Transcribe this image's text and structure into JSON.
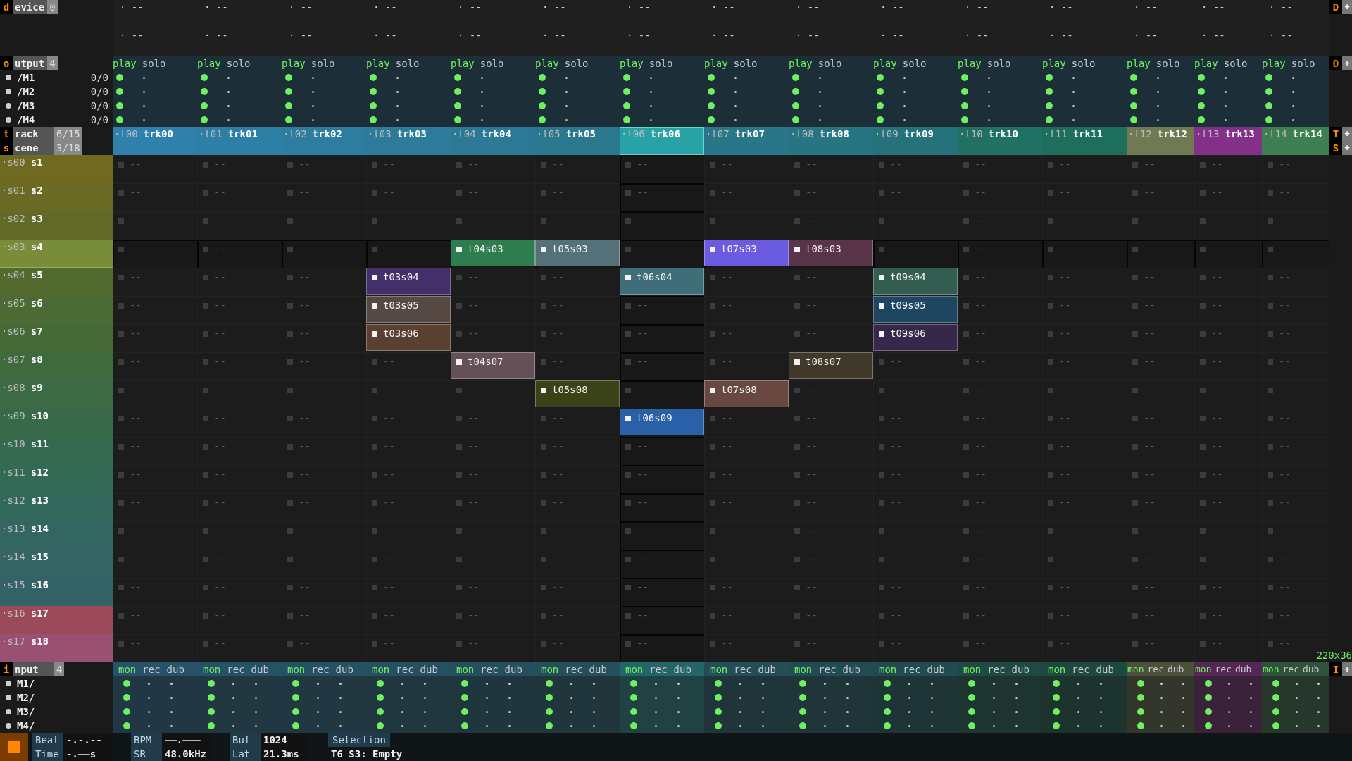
{
  "device": {
    "key": "d",
    "label": "evice",
    "count": "0",
    "right_key": "D",
    "right_add": "+"
  },
  "output": {
    "key": "o",
    "label": "utput",
    "count": "4",
    "right_key": "O",
    "right_add": "+",
    "ports": [
      {
        "name": "/M1",
        "reading": "0/0"
      },
      {
        "name": "/M2",
        "reading": "0/0"
      },
      {
        "name": "/M3",
        "reading": "0/0"
      },
      {
        "name": "/M4",
        "reading": "0/0"
      }
    ]
  },
  "track_header": {
    "key": "t",
    "label": "rack",
    "count": "6/15",
    "right_key": "T",
    "right_add": "+"
  },
  "scene_header": {
    "key": "s",
    "label": "cene",
    "count": "3/18",
    "right_key": "S",
    "right_add": "+"
  },
  "input": {
    "key": "i",
    "label": "nput",
    "count": "4",
    "right_key": "I",
    "right_add": "+",
    "ports": [
      {
        "name": "M1/"
      },
      {
        "name": "M2/"
      },
      {
        "name": "M3/"
      },
      {
        "name": "M4/"
      }
    ]
  },
  "scenes": [
    {
      "id": "·s00",
      "name": "s1",
      "color": "#706a20",
      "selected": false
    },
    {
      "id": "·s01",
      "name": "s2",
      "color": "#6b6a24",
      "selected": false
    },
    {
      "id": "·s02",
      "name": "s3",
      "color": "#636a28",
      "selected": false
    },
    {
      "id": "·s03",
      "name": "s4",
      "color": "#788c3a",
      "selected": true
    },
    {
      "id": "·s04",
      "name": "s5",
      "color": "#526a2e",
      "selected": false
    },
    {
      "id": "·s05",
      "name": "s6",
      "color": "#4b6a34",
      "selected": false
    },
    {
      "id": "·s06",
      "name": "s7",
      "color": "#456a38",
      "selected": false
    },
    {
      "id": "·s07",
      "name": "s8",
      "color": "#3f6a3e",
      "selected": false
    },
    {
      "id": "·s08",
      "name": "s9",
      "color": "#3b6a44",
      "selected": false
    },
    {
      "id": "·s09",
      "name": "s10",
      "color": "#386a4a",
      "selected": false
    },
    {
      "id": "·s10",
      "name": "s11",
      "color": "#356a50",
      "selected": false
    },
    {
      "id": "·s11",
      "name": "s12",
      "color": "#336a56",
      "selected": false
    },
    {
      "id": "·s12",
      "name": "s13",
      "color": "#33685c",
      "selected": false
    },
    {
      "id": "·s13",
      "name": "s14",
      "color": "#336660",
      "selected": false
    },
    {
      "id": "·s14",
      "name": "s15",
      "color": "#346464",
      "selected": false
    },
    {
      "id": "·s15",
      "name": "s16",
      "color": "#356268",
      "selected": false
    },
    {
      "id": "·s16",
      "name": "s17",
      "color": "#9a4a58",
      "selected": false
    },
    {
      "id": "·s17",
      "name": "s18",
      "color": "#9a5070",
      "selected": false
    }
  ],
  "tracks": [
    {
      "id": "·t00",
      "name": "trk00",
      "color": "#2f80ac",
      "selected": false,
      "device_slots": [
        "· --",
        "· --"
      ],
      "play_label": "play",
      "solo_label": "solo",
      "outputs": [
        {
          "play": true,
          "solo": false
        },
        {
          "play": true,
          "solo": false
        },
        {
          "play": true,
          "solo": false
        },
        {
          "play": true,
          "solo": false
        }
      ],
      "mon_label": "mon",
      "rec_label": "rec",
      "dub_label": "dub",
      "inputs": [
        {
          "mon": true,
          "rec": false,
          "dub": false
        },
        {
          "mon": true,
          "rec": false,
          "dub": false
        },
        {
          "mon": true,
          "rec": false,
          "dub": false
        },
        {
          "mon": true,
          "rec": false,
          "dub": false
        }
      ],
      "clips": [
        {
          "kind": "empty",
          "text": "--"
        },
        {
          "kind": "empty",
          "text": "--"
        },
        {
          "kind": "empty",
          "text": "--"
        },
        {
          "kind": "empty",
          "text": "--"
        },
        {
          "kind": "empty",
          "text": "--"
        },
        {
          "kind": "empty",
          "text": "--"
        },
        {
          "kind": "empty",
          "text": "--"
        },
        {
          "kind": "empty",
          "text": "--"
        },
        {
          "kind": "empty",
          "text": "--"
        },
        {
          "kind": "empty",
          "text": "--"
        },
        {
          "kind": "empty",
          "text": "--"
        },
        {
          "kind": "empty",
          "text": "--"
        },
        {
          "kind": "empty",
          "text": "--"
        },
        {
          "kind": "empty",
          "text": "--"
        },
        {
          "kind": "empty",
          "text": "--"
        },
        {
          "kind": "empty",
          "text": "--"
        },
        {
          "kind": "empty",
          "text": "--"
        },
        {
          "kind": "empty",
          "text": "--"
        }
      ]
    },
    {
      "id": "·t01",
      "name": "trk01",
      "color": "#2e7fa6",
      "selected": false,
      "device_slots": [
        "· --",
        "· --"
      ],
      "play_label": "play",
      "solo_label": "solo",
      "outputs": [
        {
          "play": true,
          "solo": false
        },
        {
          "play": true,
          "solo": false
        },
        {
          "play": true,
          "solo": false
        },
        {
          "play": true,
          "solo": false
        }
      ],
      "mon_label": "mon",
      "rec_label": "rec",
      "dub_label": "dub",
      "inputs": [
        {
          "mon": true,
          "rec": false,
          "dub": false
        },
        {
          "mon": true,
          "rec": false,
          "dub": false
        },
        {
          "mon": true,
          "rec": false,
          "dub": false
        },
        {
          "mon": true,
          "rec": false,
          "dub": false
        }
      ],
      "clips": [
        {
          "kind": "empty",
          "text": "--"
        },
        {
          "kind": "empty",
          "text": "--"
        },
        {
          "kind": "empty",
          "text": "--"
        },
        {
          "kind": "empty",
          "text": "--"
        },
        {
          "kind": "empty",
          "text": "--"
        },
        {
          "kind": "empty",
          "text": "--"
        },
        {
          "kind": "empty",
          "text": "--"
        },
        {
          "kind": "empty",
          "text": "--"
        },
        {
          "kind": "empty",
          "text": "--"
        },
        {
          "kind": "empty",
          "text": "--"
        },
        {
          "kind": "empty",
          "text": "--"
        },
        {
          "kind": "empty",
          "text": "--"
        },
        {
          "kind": "empty",
          "text": "--"
        },
        {
          "kind": "empty",
          "text": "--"
        },
        {
          "kind": "empty",
          "text": "--"
        },
        {
          "kind": "empty",
          "text": "--"
        },
        {
          "kind": "empty",
          "text": "--"
        },
        {
          "kind": "empty",
          "text": "--"
        }
      ]
    },
    {
      "id": "·t02",
      "name": "trk02",
      "color": "#2d7da0",
      "selected": false,
      "device_slots": [
        "· --",
        "· --"
      ],
      "play_label": "play",
      "solo_label": "solo",
      "outputs": [
        {
          "play": true,
          "solo": false
        },
        {
          "play": true,
          "solo": false
        },
        {
          "play": true,
          "solo": false
        },
        {
          "play": true,
          "solo": false
        }
      ],
      "mon_label": "mon",
      "rec_label": "rec",
      "dub_label": "dub",
      "inputs": [
        {
          "mon": true,
          "rec": false,
          "dub": false
        },
        {
          "mon": true,
          "rec": false,
          "dub": false
        },
        {
          "mon": true,
          "rec": false,
          "dub": false
        },
        {
          "mon": true,
          "rec": false,
          "dub": false
        }
      ],
      "clips": [
        {
          "kind": "empty",
          "text": "--"
        },
        {
          "kind": "empty",
          "text": "--"
        },
        {
          "kind": "empty",
          "text": "--"
        },
        {
          "kind": "empty",
          "text": "--"
        },
        {
          "kind": "empty",
          "text": "--"
        },
        {
          "kind": "empty",
          "text": "--"
        },
        {
          "kind": "empty",
          "text": "--"
        },
        {
          "kind": "empty",
          "text": "--"
        },
        {
          "kind": "empty",
          "text": "--"
        },
        {
          "kind": "empty",
          "text": "--"
        },
        {
          "kind": "empty",
          "text": "--"
        },
        {
          "kind": "empty",
          "text": "--"
        },
        {
          "kind": "empty",
          "text": "--"
        },
        {
          "kind": "empty",
          "text": "--"
        },
        {
          "kind": "empty",
          "text": "--"
        },
        {
          "kind": "empty",
          "text": "--"
        },
        {
          "kind": "empty",
          "text": "--"
        },
        {
          "kind": "empty",
          "text": "--"
        }
      ]
    },
    {
      "id": "·t03",
      "name": "trk03",
      "color": "#2c7b9a",
      "selected": false,
      "device_slots": [
        "· --",
        "· --"
      ],
      "play_label": "play",
      "solo_label": "solo",
      "outputs": [
        {
          "play": true,
          "solo": false
        },
        {
          "play": true,
          "solo": false
        },
        {
          "play": true,
          "solo": false
        },
        {
          "play": true,
          "solo": false
        }
      ],
      "mon_label": "mon",
      "rec_label": "rec",
      "dub_label": "dub",
      "inputs": [
        {
          "mon": true,
          "rec": false,
          "dub": false
        },
        {
          "mon": true,
          "rec": false,
          "dub": false
        },
        {
          "mon": true,
          "rec": false,
          "dub": false
        },
        {
          "mon": true,
          "rec": false,
          "dub": false
        }
      ],
      "clips": [
        {
          "kind": "empty",
          "text": "--"
        },
        {
          "kind": "empty",
          "text": "--"
        },
        {
          "kind": "empty",
          "text": "--"
        },
        {
          "kind": "empty",
          "text": "--"
        },
        {
          "kind": "clip",
          "name": "t03s04",
          "color": "#432f6a"
        },
        {
          "kind": "clip",
          "name": "t03s05",
          "color": "#564842"
        },
        {
          "kind": "clip",
          "name": "t03s06",
          "color": "#5a4030"
        },
        {
          "kind": "empty",
          "text": "--"
        },
        {
          "kind": "empty",
          "text": "--"
        },
        {
          "kind": "empty",
          "text": "--"
        },
        {
          "kind": "empty",
          "text": "--"
        },
        {
          "kind": "empty",
          "text": "--"
        },
        {
          "kind": "empty",
          "text": "--"
        },
        {
          "kind": "empty",
          "text": "--"
        },
        {
          "kind": "empty",
          "text": "--"
        },
        {
          "kind": "empty",
          "text": "--"
        },
        {
          "kind": "empty",
          "text": "--"
        },
        {
          "kind": "empty",
          "text": "--"
        }
      ]
    },
    {
      "id": "·t04",
      "name": "trk04",
      "color": "#2b7994",
      "selected": false,
      "device_slots": [
        "· --",
        "· --"
      ],
      "play_label": "play",
      "solo_label": "solo",
      "outputs": [
        {
          "play": true,
          "solo": false
        },
        {
          "play": true,
          "solo": false
        },
        {
          "play": true,
          "solo": false
        },
        {
          "play": true,
          "solo": false
        }
      ],
      "mon_label": "mon",
      "rec_label": "rec",
      "dub_label": "dub",
      "inputs": [
        {
          "mon": true,
          "rec": false,
          "dub": false
        },
        {
          "mon": true,
          "rec": false,
          "dub": false
        },
        {
          "mon": true,
          "rec": false,
          "dub": false
        },
        {
          "mon": true,
          "rec": false,
          "dub": false
        }
      ],
      "clips": [
        {
          "kind": "empty",
          "text": "--"
        },
        {
          "kind": "empty",
          "text": "--"
        },
        {
          "kind": "empty",
          "text": "--"
        },
        {
          "kind": "clip",
          "name": "t04s03",
          "color": "#2e7d4f"
        },
        {
          "kind": "empty",
          "text": "--"
        },
        {
          "kind": "empty",
          "text": "--"
        },
        {
          "kind": "empty",
          "text": "--"
        },
        {
          "kind": "clip",
          "name": "t04s07",
          "color": "#665058"
        },
        {
          "kind": "empty",
          "text": "--"
        },
        {
          "kind": "empty",
          "text": "--"
        },
        {
          "kind": "empty",
          "text": "--"
        },
        {
          "kind": "empty",
          "text": "--"
        },
        {
          "kind": "empty",
          "text": "--"
        },
        {
          "kind": "empty",
          "text": "--"
        },
        {
          "kind": "empty",
          "text": "--"
        },
        {
          "kind": "empty",
          "text": "--"
        },
        {
          "kind": "empty",
          "text": "--"
        },
        {
          "kind": "empty",
          "text": "--"
        }
      ]
    },
    {
      "id": "·t05",
      "name": "trk05",
      "color": "#2a788e",
      "selected": false,
      "device_slots": [
        "· --",
        "· --"
      ],
      "play_label": "play",
      "solo_label": "solo",
      "outputs": [
        {
          "play": true,
          "solo": false
        },
        {
          "play": true,
          "solo": false
        },
        {
          "play": true,
          "solo": false
        },
        {
          "play": true,
          "solo": false
        }
      ],
      "mon_label": "mon",
      "rec_label": "rec",
      "dub_label": "dub",
      "inputs": [
        {
          "mon": true,
          "rec": false,
          "dub": false
        },
        {
          "mon": true,
          "rec": false,
          "dub": false
        },
        {
          "mon": true,
          "rec": false,
          "dub": false
        },
        {
          "mon": true,
          "rec": false,
          "dub": false
        }
      ],
      "clips": [
        {
          "kind": "empty",
          "text": "--"
        },
        {
          "kind": "empty",
          "text": "--"
        },
        {
          "kind": "empty",
          "text": "--"
        },
        {
          "kind": "clip",
          "name": "t05s03",
          "color": "#547078"
        },
        {
          "kind": "empty",
          "text": "--"
        },
        {
          "kind": "empty",
          "text": "--"
        },
        {
          "kind": "empty",
          "text": "--"
        },
        {
          "kind": "empty",
          "text": "--"
        },
        {
          "kind": "clip",
          "name": "t05s08",
          "color": "#3a4218"
        },
        {
          "kind": "empty",
          "text": "--"
        },
        {
          "kind": "empty",
          "text": "--"
        },
        {
          "kind": "empty",
          "text": "--"
        },
        {
          "kind": "empty",
          "text": "--"
        },
        {
          "kind": "empty",
          "text": "--"
        },
        {
          "kind": "empty",
          "text": "--"
        },
        {
          "kind": "empty",
          "text": "--"
        },
        {
          "kind": "empty",
          "text": "--"
        },
        {
          "kind": "empty",
          "text": "--"
        }
      ]
    },
    {
      "id": "·t06",
      "name": "trk06",
      "color": "#29a2a6",
      "selected": true,
      "device_slots": [
        "· --",
        "· --"
      ],
      "play_label": "play",
      "solo_label": "solo",
      "outputs": [
        {
          "play": true,
          "solo": false
        },
        {
          "play": true,
          "solo": false
        },
        {
          "play": true,
          "solo": false
        },
        {
          "play": true,
          "solo": false
        }
      ],
      "mon_label": "mon",
      "rec_label": "rec",
      "dub_label": "dub",
      "inputs": [
        {
          "mon": true,
          "rec": false,
          "dub": false
        },
        {
          "mon": true,
          "rec": false,
          "dub": false
        },
        {
          "mon": true,
          "rec": false,
          "dub": false
        },
        {
          "mon": true,
          "rec": false,
          "dub": false
        }
      ],
      "clips": [
        {
          "kind": "empty",
          "text": "--"
        },
        {
          "kind": "empty",
          "text": "--"
        },
        {
          "kind": "empty",
          "text": "--"
        },
        {
          "kind": "empty",
          "text": "--"
        },
        {
          "kind": "clip",
          "name": "t06s04",
          "color": "#3f6e78"
        },
        {
          "kind": "empty",
          "text": "--"
        },
        {
          "kind": "empty",
          "text": "--"
        },
        {
          "kind": "empty",
          "text": "--"
        },
        {
          "kind": "empty",
          "text": "--"
        },
        {
          "kind": "clip",
          "name": "t06s09",
          "color": "#2a60a8"
        },
        {
          "kind": "empty",
          "text": "--"
        },
        {
          "kind": "empty",
          "text": "--"
        },
        {
          "kind": "empty",
          "text": "--"
        },
        {
          "kind": "empty",
          "text": "--"
        },
        {
          "kind": "empty",
          "text": "--"
        },
        {
          "kind": "empty",
          "text": "--"
        },
        {
          "kind": "empty",
          "text": "--"
        },
        {
          "kind": "empty",
          "text": "--"
        }
      ]
    },
    {
      "id": "·t07",
      "name": "trk07",
      "color": "#287688",
      "selected": false,
      "device_slots": [
        "· --",
        "· --"
      ],
      "play_label": "play",
      "solo_label": "solo",
      "outputs": [
        {
          "play": true,
          "solo": false
        },
        {
          "play": true,
          "solo": false
        },
        {
          "play": true,
          "solo": false
        },
        {
          "play": true,
          "solo": false
        }
      ],
      "mon_label": "mon",
      "rec_label": "rec",
      "dub_label": "dub",
      "inputs": [
        {
          "mon": true,
          "rec": false,
          "dub": false
        },
        {
          "mon": true,
          "rec": false,
          "dub": false
        },
        {
          "mon": true,
          "rec": false,
          "dub": false
        },
        {
          "mon": true,
          "rec": false,
          "dub": false
        }
      ],
      "clips": [
        {
          "kind": "empty",
          "text": "--"
        },
        {
          "kind": "empty",
          "text": "--"
        },
        {
          "kind": "empty",
          "text": "--"
        },
        {
          "kind": "clip",
          "name": "t07s03",
          "color": "#6b5be0"
        },
        {
          "kind": "empty",
          "text": "--"
        },
        {
          "kind": "empty",
          "text": "--"
        },
        {
          "kind": "empty",
          "text": "--"
        },
        {
          "kind": "empty",
          "text": "--"
        },
        {
          "kind": "clip",
          "name": "t07s08",
          "color": "#684840"
        },
        {
          "kind": "empty",
          "text": "--"
        },
        {
          "kind": "empty",
          "text": "--"
        },
        {
          "kind": "empty",
          "text": "--"
        },
        {
          "kind": "empty",
          "text": "--"
        },
        {
          "kind": "empty",
          "text": "--"
        },
        {
          "kind": "empty",
          "text": "--"
        },
        {
          "kind": "empty",
          "text": "--"
        },
        {
          "kind": "empty",
          "text": "--"
        },
        {
          "kind": "empty",
          "text": "--"
        }
      ]
    },
    {
      "id": "·t08",
      "name": "trk08",
      "color": "#277482",
      "selected": false,
      "device_slots": [
        "· --",
        "· --"
      ],
      "play_label": "play",
      "solo_label": "solo",
      "outputs": [
        {
          "play": true,
          "solo": false
        },
        {
          "play": true,
          "solo": false
        },
        {
          "play": true,
          "solo": false
        },
        {
          "play": true,
          "solo": false
        }
      ],
      "mon_label": "mon",
      "rec_label": "rec",
      "dub_label": "dub",
      "inputs": [
        {
          "mon": true,
          "rec": false,
          "dub": false
        },
        {
          "mon": true,
          "rec": false,
          "dub": false
        },
        {
          "mon": true,
          "rec": false,
          "dub": false
        },
        {
          "mon": true,
          "rec": false,
          "dub": false
        }
      ],
      "clips": [
        {
          "kind": "empty",
          "text": "--"
        },
        {
          "kind": "empty",
          "text": "--"
        },
        {
          "kind": "empty",
          "text": "--"
        },
        {
          "kind": "clip",
          "name": "t08s03",
          "color": "#5a3448"
        },
        {
          "kind": "empty",
          "text": "--"
        },
        {
          "kind": "empty",
          "text": "--"
        },
        {
          "kind": "empty",
          "text": "--"
        },
        {
          "kind": "clip",
          "name": "t08s07",
          "color": "#403828"
        },
        {
          "kind": "empty",
          "text": "--"
        },
        {
          "kind": "empty",
          "text": "--"
        },
        {
          "kind": "empty",
          "text": "--"
        },
        {
          "kind": "empty",
          "text": "--"
        },
        {
          "kind": "empty",
          "text": "--"
        },
        {
          "kind": "empty",
          "text": "--"
        },
        {
          "kind": "empty",
          "text": "--"
        },
        {
          "kind": "empty",
          "text": "--"
        },
        {
          "kind": "empty",
          "text": "--"
        },
        {
          "kind": "empty",
          "text": "--"
        }
      ]
    },
    {
      "id": "·t09",
      "name": "trk09",
      "color": "#26727c",
      "selected": false,
      "device_slots": [
        "· --",
        "· --"
      ],
      "play_label": "play",
      "solo_label": "solo",
      "outputs": [
        {
          "play": true,
          "solo": false
        },
        {
          "play": true,
          "solo": false
        },
        {
          "play": true,
          "solo": false
        },
        {
          "play": true,
          "solo": false
        }
      ],
      "mon_label": "mon",
      "rec_label": "rec",
      "dub_label": "dub",
      "inputs": [
        {
          "mon": true,
          "rec": false,
          "dub": false
        },
        {
          "mon": true,
          "rec": false,
          "dub": false
        },
        {
          "mon": true,
          "rec": false,
          "dub": false
        },
        {
          "mon": true,
          "rec": false,
          "dub": false
        }
      ],
      "clips": [
        {
          "kind": "empty",
          "text": "--"
        },
        {
          "kind": "empty",
          "text": "--"
        },
        {
          "kind": "empty",
          "text": "--"
        },
        {
          "kind": "empty",
          "text": "--"
        },
        {
          "kind": "clip",
          "name": "t09s04",
          "color": "#355e52"
        },
        {
          "kind": "clip",
          "name": "t09s05",
          "color": "#1e4660"
        },
        {
          "kind": "clip",
          "name": "t09s06",
          "color": "#35284a"
        },
        {
          "kind": "empty",
          "text": "--"
        },
        {
          "kind": "empty",
          "text": "--"
        },
        {
          "kind": "empty",
          "text": "--"
        },
        {
          "kind": "empty",
          "text": "--"
        },
        {
          "kind": "empty",
          "text": "--"
        },
        {
          "kind": "empty",
          "text": "--"
        },
        {
          "kind": "empty",
          "text": "--"
        },
        {
          "kind": "empty",
          "text": "--"
        },
        {
          "kind": "empty",
          "text": "--"
        },
        {
          "kind": "empty",
          "text": "--"
        },
        {
          "kind": "empty",
          "text": "--"
        }
      ]
    },
    {
      "id": "·t10",
      "name": "trk10",
      "color": "#217064",
      "selected": false,
      "device_slots": [
        "· --",
        "· --"
      ],
      "play_label": "play",
      "solo_label": "solo",
      "outputs": [
        {
          "play": true,
          "solo": false
        },
        {
          "play": true,
          "solo": false
        },
        {
          "play": true,
          "solo": false
        },
        {
          "play": true,
          "solo": false
        }
      ],
      "mon_label": "mon",
      "rec_label": "rec",
      "dub_label": "dub",
      "inputs": [
        {
          "mon": true,
          "rec": false,
          "dub": false
        },
        {
          "mon": true,
          "rec": false,
          "dub": false
        },
        {
          "mon": true,
          "rec": false,
          "dub": false
        },
        {
          "mon": true,
          "rec": false,
          "dub": false
        }
      ],
      "clips": [
        {
          "kind": "empty",
          "text": "--"
        },
        {
          "kind": "empty",
          "text": "--"
        },
        {
          "kind": "empty",
          "text": "--"
        },
        {
          "kind": "empty",
          "text": "--"
        },
        {
          "kind": "empty",
          "text": "--"
        },
        {
          "kind": "empty",
          "text": "--"
        },
        {
          "kind": "empty",
          "text": "--"
        },
        {
          "kind": "empty",
          "text": "--"
        },
        {
          "kind": "empty",
          "text": "--"
        },
        {
          "kind": "empty",
          "text": "--"
        },
        {
          "kind": "empty",
          "text": "--"
        },
        {
          "kind": "empty",
          "text": "--"
        },
        {
          "kind": "empty",
          "text": "--"
        },
        {
          "kind": "empty",
          "text": "--"
        },
        {
          "kind": "empty",
          "text": "--"
        },
        {
          "kind": "empty",
          "text": "--"
        },
        {
          "kind": "empty",
          "text": "--"
        },
        {
          "kind": "empty",
          "text": "--"
        }
      ]
    },
    {
      "id": "·t11",
      "name": "trk11",
      "color": "#1e6e5c",
      "selected": false,
      "device_slots": [
        "· --",
        "· --"
      ],
      "play_label": "play",
      "solo_label": "solo",
      "outputs": [
        {
          "play": true,
          "solo": false
        },
        {
          "play": true,
          "solo": false
        },
        {
          "play": true,
          "solo": false
        },
        {
          "play": true,
          "solo": false
        }
      ],
      "mon_label": "mon",
      "rec_label": "rec",
      "dub_label": "dub",
      "inputs": [
        {
          "mon": true,
          "rec": false,
          "dub": false
        },
        {
          "mon": true,
          "rec": false,
          "dub": false
        },
        {
          "mon": true,
          "rec": false,
          "dub": false
        },
        {
          "mon": true,
          "rec": false,
          "dub": false
        }
      ],
      "clips": [
        {
          "kind": "empty",
          "text": "--"
        },
        {
          "kind": "empty",
          "text": "--"
        },
        {
          "kind": "empty",
          "text": "--"
        },
        {
          "kind": "empty",
          "text": "--"
        },
        {
          "kind": "empty",
          "text": "--"
        },
        {
          "kind": "empty",
          "text": "--"
        },
        {
          "kind": "empty",
          "text": "--"
        },
        {
          "kind": "empty",
          "text": "--"
        },
        {
          "kind": "empty",
          "text": "--"
        },
        {
          "kind": "empty",
          "text": "--"
        },
        {
          "kind": "empty",
          "text": "--"
        },
        {
          "kind": "empty",
          "text": "--"
        },
        {
          "kind": "empty",
          "text": "--"
        },
        {
          "kind": "empty",
          "text": "--"
        },
        {
          "kind": "empty",
          "text": "--"
        },
        {
          "kind": "empty",
          "text": "--"
        },
        {
          "kind": "empty",
          "text": "--"
        },
        {
          "kind": "empty",
          "text": "--"
        }
      ]
    },
    {
      "id": "·t12",
      "name": "trk12",
      "color": "#6f7a52",
      "selected": false,
      "device_slots": [
        "· --",
        "· --"
      ],
      "play_label": "play",
      "solo_label": "solo",
      "outputs": [
        {
          "play": true,
          "solo": false
        },
        {
          "play": true,
          "solo": false
        },
        {
          "play": true,
          "solo": false
        },
        {
          "play": true,
          "solo": false
        }
      ],
      "mon_label": "mon",
      "rec_label": "rec",
      "dub_label": "dub",
      "inputs": [
        {
          "mon": true,
          "rec": false,
          "dub": false
        },
        {
          "mon": true,
          "rec": false,
          "dub": false
        },
        {
          "mon": true,
          "rec": false,
          "dub": false
        },
        {
          "mon": true,
          "rec": false,
          "dub": false
        }
      ],
      "clips": [
        {
          "kind": "empty",
          "text": "--"
        },
        {
          "kind": "empty",
          "text": "--"
        },
        {
          "kind": "empty",
          "text": "--"
        },
        {
          "kind": "empty",
          "text": "--"
        },
        {
          "kind": "empty",
          "text": "--"
        },
        {
          "kind": "empty",
          "text": "--"
        },
        {
          "kind": "empty",
          "text": "--"
        },
        {
          "kind": "empty",
          "text": "--"
        },
        {
          "kind": "empty",
          "text": "--"
        },
        {
          "kind": "empty",
          "text": "--"
        },
        {
          "kind": "empty",
          "text": "--"
        },
        {
          "kind": "empty",
          "text": "--"
        },
        {
          "kind": "empty",
          "text": "--"
        },
        {
          "kind": "empty",
          "text": "--"
        },
        {
          "kind": "empty",
          "text": "--"
        },
        {
          "kind": "empty",
          "text": "--"
        },
        {
          "kind": "empty",
          "text": "--"
        },
        {
          "kind": "empty",
          "text": "--"
        }
      ]
    },
    {
      "id": "·t13",
      "name": "trk13",
      "color": "#833088",
      "selected": false,
      "device_slots": [
        "· --",
        "· --"
      ],
      "play_label": "play",
      "solo_label": "solo",
      "outputs": [
        {
          "play": true,
          "solo": false
        },
        {
          "play": true,
          "solo": false
        },
        {
          "play": true,
          "solo": false
        },
        {
          "play": true,
          "solo": false
        }
      ],
      "mon_label": "mon",
      "rec_label": "rec",
      "dub_label": "dub",
      "inputs": [
        {
          "mon": true,
          "rec": false,
          "dub": false
        },
        {
          "mon": true,
          "rec": false,
          "dub": false
        },
        {
          "mon": true,
          "rec": false,
          "dub": false
        },
        {
          "mon": true,
          "rec": false,
          "dub": false
        }
      ],
      "clips": [
        {
          "kind": "empty",
          "text": "--"
        },
        {
          "kind": "empty",
          "text": "--"
        },
        {
          "kind": "empty",
          "text": "--"
        },
        {
          "kind": "empty",
          "text": "--"
        },
        {
          "kind": "empty",
          "text": "--"
        },
        {
          "kind": "empty",
          "text": "--"
        },
        {
          "kind": "empty",
          "text": "--"
        },
        {
          "kind": "empty",
          "text": "--"
        },
        {
          "kind": "empty",
          "text": "--"
        },
        {
          "kind": "empty",
          "text": "--"
        },
        {
          "kind": "empty",
          "text": "--"
        },
        {
          "kind": "empty",
          "text": "--"
        },
        {
          "kind": "empty",
          "text": "--"
        },
        {
          "kind": "empty",
          "text": "--"
        },
        {
          "kind": "empty",
          "text": "--"
        },
        {
          "kind": "empty",
          "text": "--"
        },
        {
          "kind": "empty",
          "text": "--"
        },
        {
          "kind": "empty",
          "text": "--"
        }
      ]
    },
    {
      "id": "·t14",
      "name": "trk14",
      "color": "#3e7f52",
      "selected": false,
      "device_slots": [
        "· --",
        "· --"
      ],
      "play_label": "play",
      "solo_label": "solo",
      "outputs": [
        {
          "play": true,
          "solo": false
        },
        {
          "play": true,
          "solo": false
        },
        {
          "play": true,
          "solo": false
        },
        {
          "play": true,
          "solo": false
        }
      ],
      "mon_label": "mon",
      "rec_label": "rec",
      "dub_label": "dub",
      "inputs": [
        {
          "mon": true,
          "rec": false,
          "dub": false
        },
        {
          "mon": true,
          "rec": false,
          "dub": false
        },
        {
          "mon": true,
          "rec": false,
          "dub": false
        },
        {
          "mon": true,
          "rec": false,
          "dub": false
        }
      ],
      "clips": [
        {
          "kind": "empty",
          "text": "--"
        },
        {
          "kind": "empty",
          "text": "--"
        },
        {
          "kind": "empty",
          "text": "--"
        },
        {
          "kind": "empty",
          "text": "--"
        },
        {
          "kind": "empty",
          "text": "--"
        },
        {
          "kind": "empty",
          "text": "--"
        },
        {
          "kind": "empty",
          "text": "--"
        },
        {
          "kind": "empty",
          "text": "--"
        },
        {
          "kind": "empty",
          "text": "--"
        },
        {
          "kind": "empty",
          "text": "--"
        },
        {
          "kind": "empty",
          "text": "--"
        },
        {
          "kind": "empty",
          "text": "--"
        },
        {
          "kind": "empty",
          "text": "--"
        },
        {
          "kind": "empty",
          "text": "--"
        },
        {
          "kind": "empty",
          "text": "--"
        },
        {
          "kind": "empty",
          "text": "--"
        },
        {
          "kind": "empty",
          "text": "--"
        },
        {
          "kind": "empty",
          "text": "--"
        }
      ]
    }
  ],
  "terminal_size": "220x36",
  "status": {
    "transport_playing": false,
    "fields": [
      {
        "label": "Beat",
        "value": "-.-.--"
      },
      {
        "label": "Time",
        "value": "-.——s"
      },
      {
        "label": "BPM",
        "value": "——.———"
      },
      {
        "label": "SR",
        "value": "48.0kHz"
      },
      {
        "label": "Buf",
        "value": "1024"
      },
      {
        "label": "Lat",
        "value": "21.3ms"
      }
    ],
    "selection_label": "Selection",
    "selection_value": "T6 S3: Empty"
  }
}
